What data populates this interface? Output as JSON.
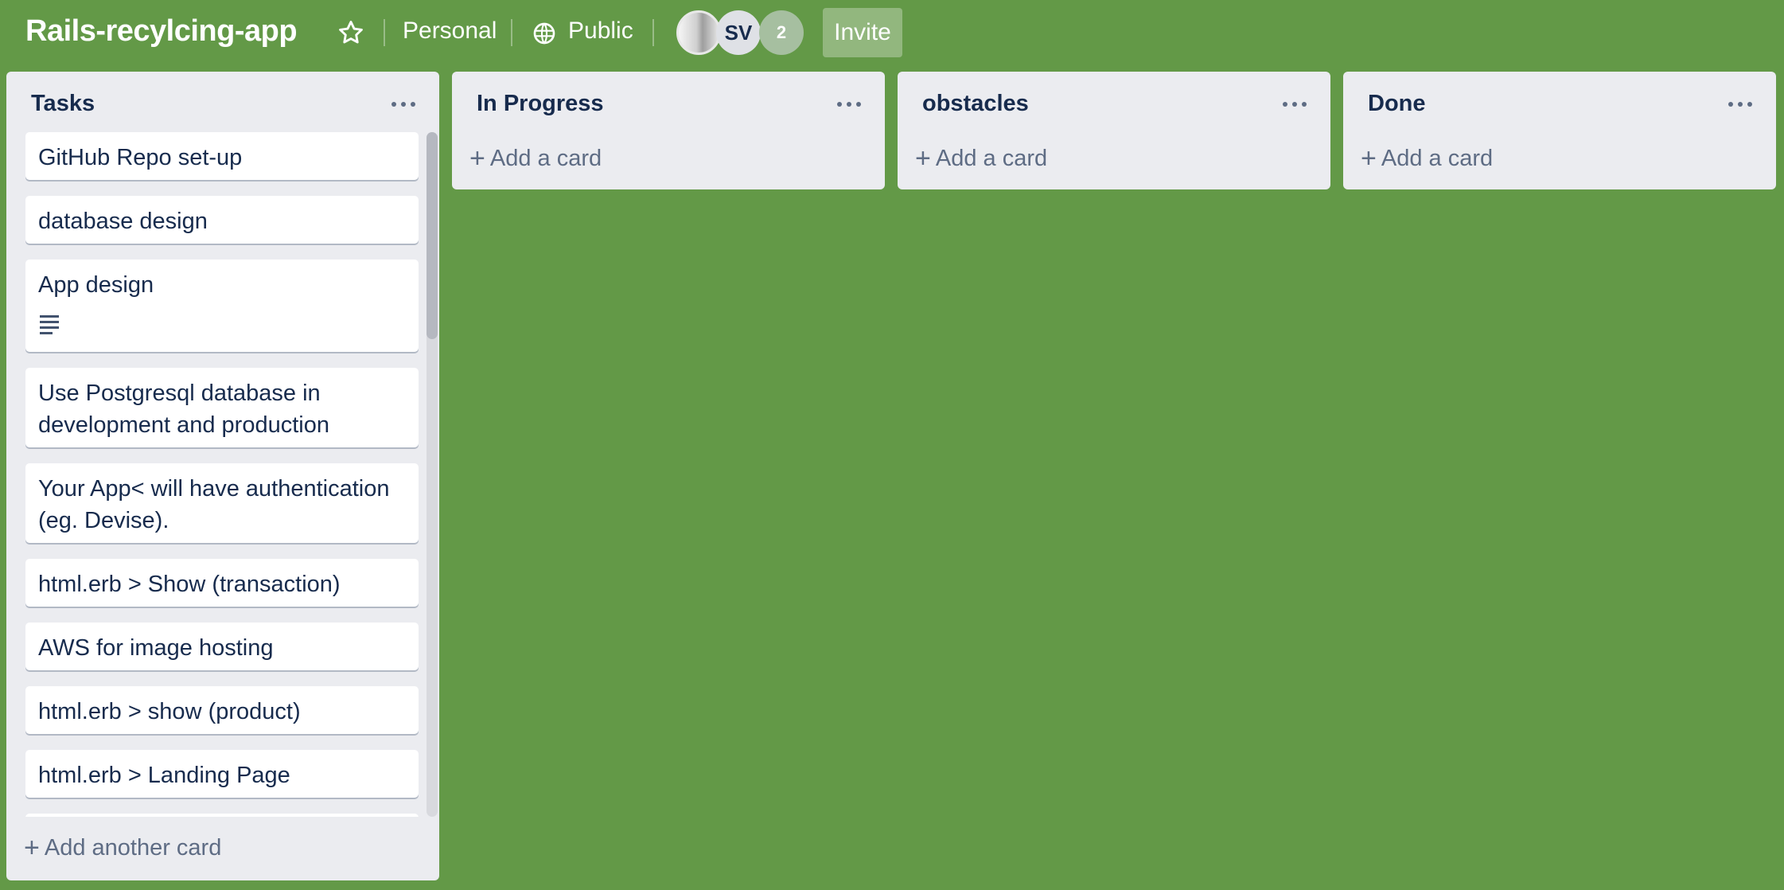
{
  "board": {
    "title": "Rails-recylcing-app",
    "visibility_team": "Personal",
    "visibility": "Public",
    "member_count": "2",
    "member_initials": "SV",
    "invite_label": "Invite"
  },
  "lists": [
    {
      "title": "Tasks",
      "cards": [
        "GitHub Repo set-up",
        "database design",
        "App design",
        "Use Postgresql database in development and production",
        "Your App< will have authentication (eg. Devise).",
        "html.erb > Show (transaction)",
        "AWS for image hosting",
        "html.erb > show (product)",
        "html.erb > Landing Page"
      ],
      "add_label": "Add another card"
    },
    {
      "title": "In Progress",
      "add_label": "Add a card"
    },
    {
      "title": "obstacles",
      "add_label": "Add a card"
    },
    {
      "title": "Done",
      "add_label": "Add a card"
    }
  ],
  "colors": {
    "board_bg": "#639947",
    "list_bg": "#ebecf0",
    "card_text": "#172b4d",
    "muted_text": "#5e6c84"
  },
  "icons": [
    "star-icon",
    "globe-icon",
    "more-icon",
    "plus-icon",
    "description-icon"
  ]
}
